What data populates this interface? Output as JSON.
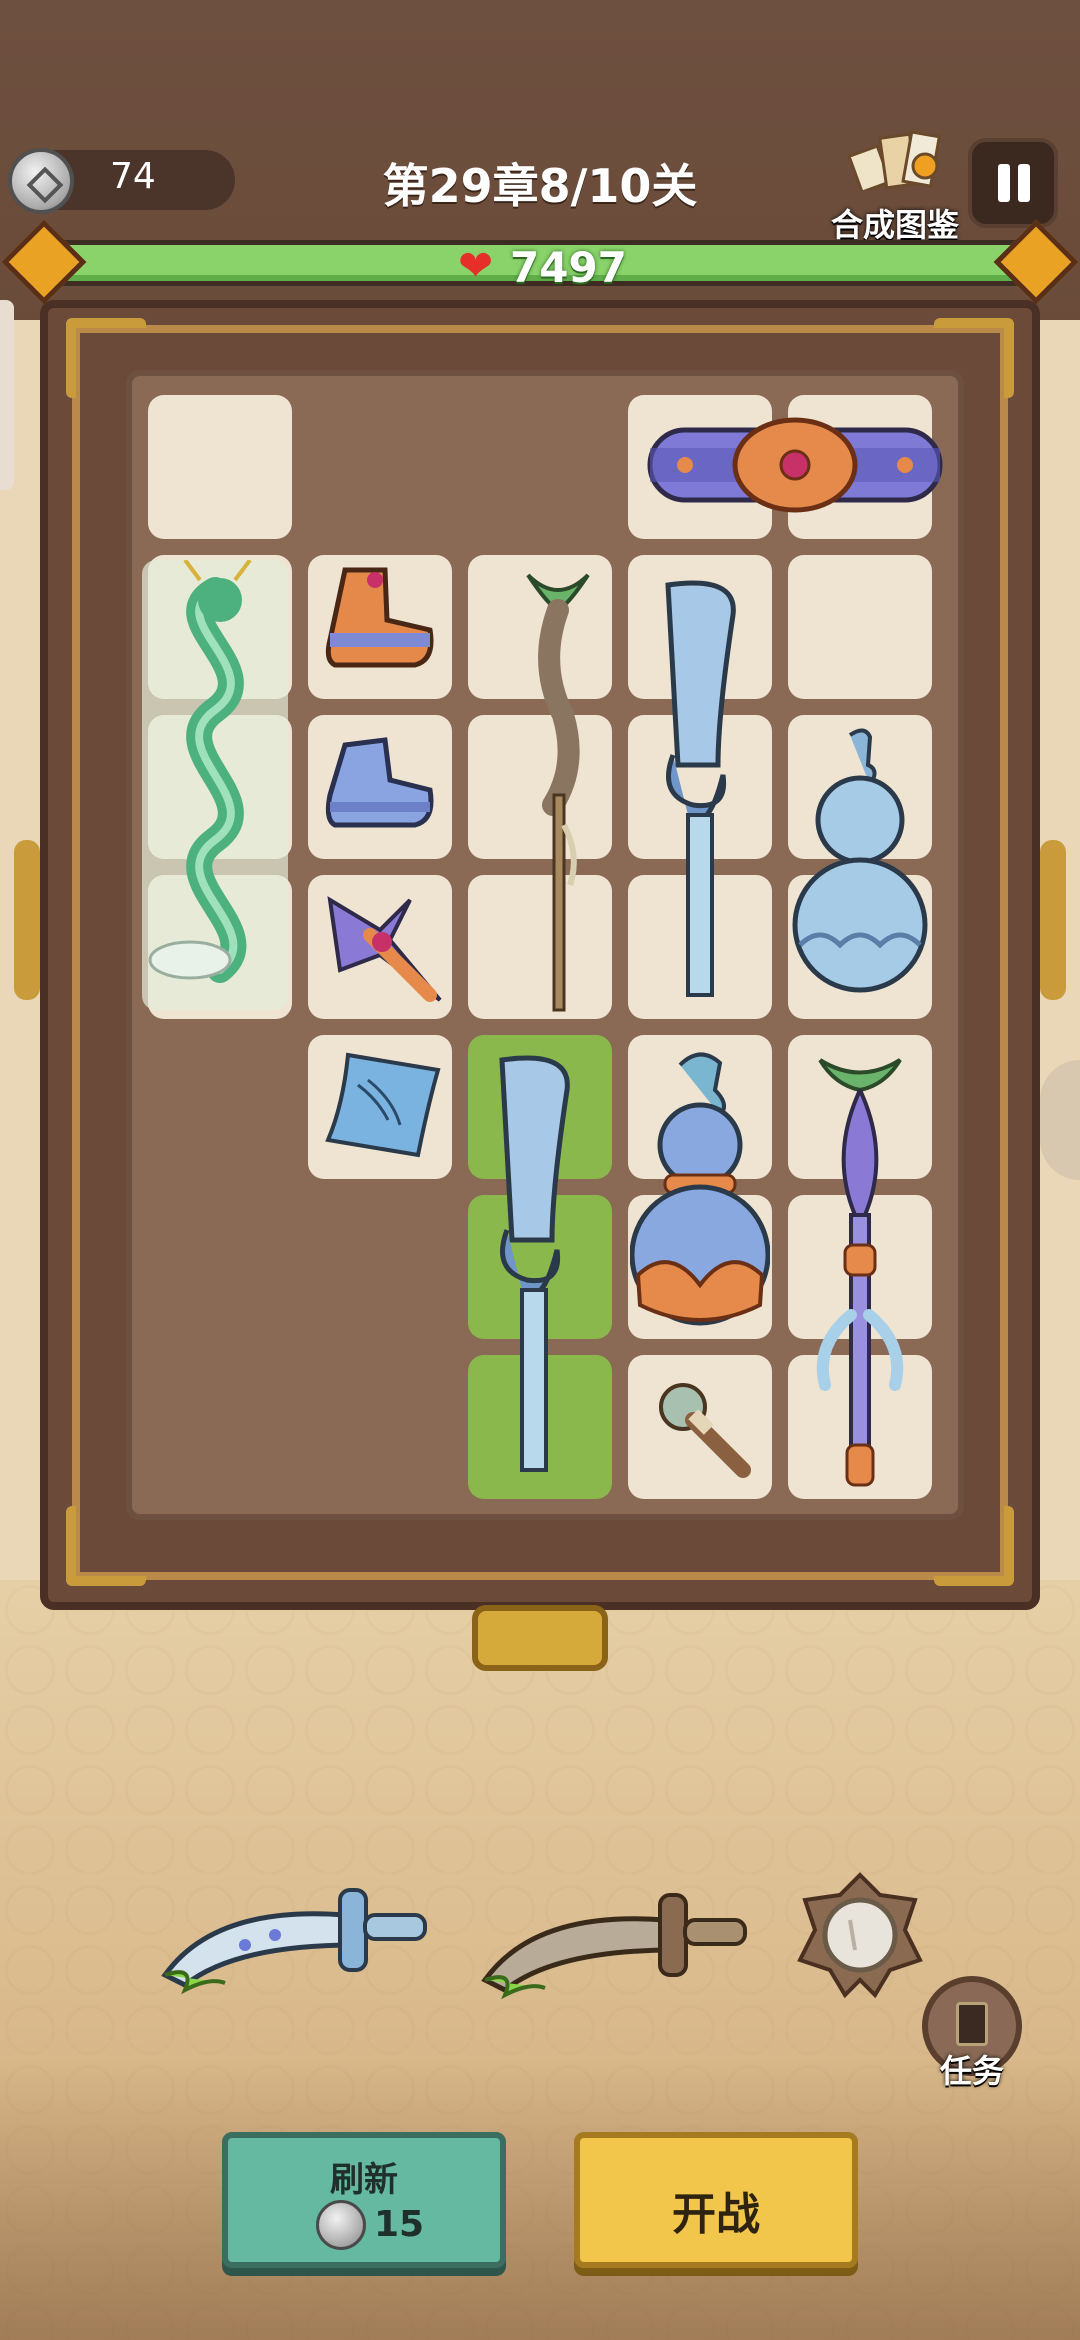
{
  "header": {
    "coins": "74",
    "level_title": "第29章8/10关",
    "codex_label": "合成图鉴",
    "pause_icon": "pause-icon"
  },
  "hp": {
    "icon": "heart-icon",
    "value": "7497"
  },
  "board": {
    "items": [
      {
        "name": "dragon",
        "cells": 3
      },
      {
        "name": "belt",
        "cells": 2
      },
      {
        "name": "boots-orange",
        "cells": 1
      },
      {
        "name": "boots-blue",
        "cells": 1
      },
      {
        "name": "brush-spear",
        "cells": 3
      },
      {
        "name": "guandao-blade",
        "cells": 3
      },
      {
        "name": "gourd-blue",
        "cells": 2
      },
      {
        "name": "lotus-dart",
        "cells": 1
      },
      {
        "name": "scroll-talisman",
        "cells": 1
      },
      {
        "name": "guandao-blade-selected",
        "cells": 3
      },
      {
        "name": "gourd-cloud",
        "cells": 2
      },
      {
        "name": "ornate-staff",
        "cells": 3
      },
      {
        "name": "torch",
        "cells": 1
      }
    ]
  },
  "bottom": {
    "weapons": [
      "jade-sword-icon",
      "bronze-sword-icon",
      "mirror-icon"
    ],
    "task_label": "任务",
    "refresh_label": "刷新",
    "refresh_cost": "15",
    "start_label": "开战"
  },
  "colors": {
    "hp_green": "#8ad36b",
    "refresh_teal": "#64b9a0",
    "start_yellow": "#f2c64a",
    "frame_gold": "#c99b3a"
  }
}
